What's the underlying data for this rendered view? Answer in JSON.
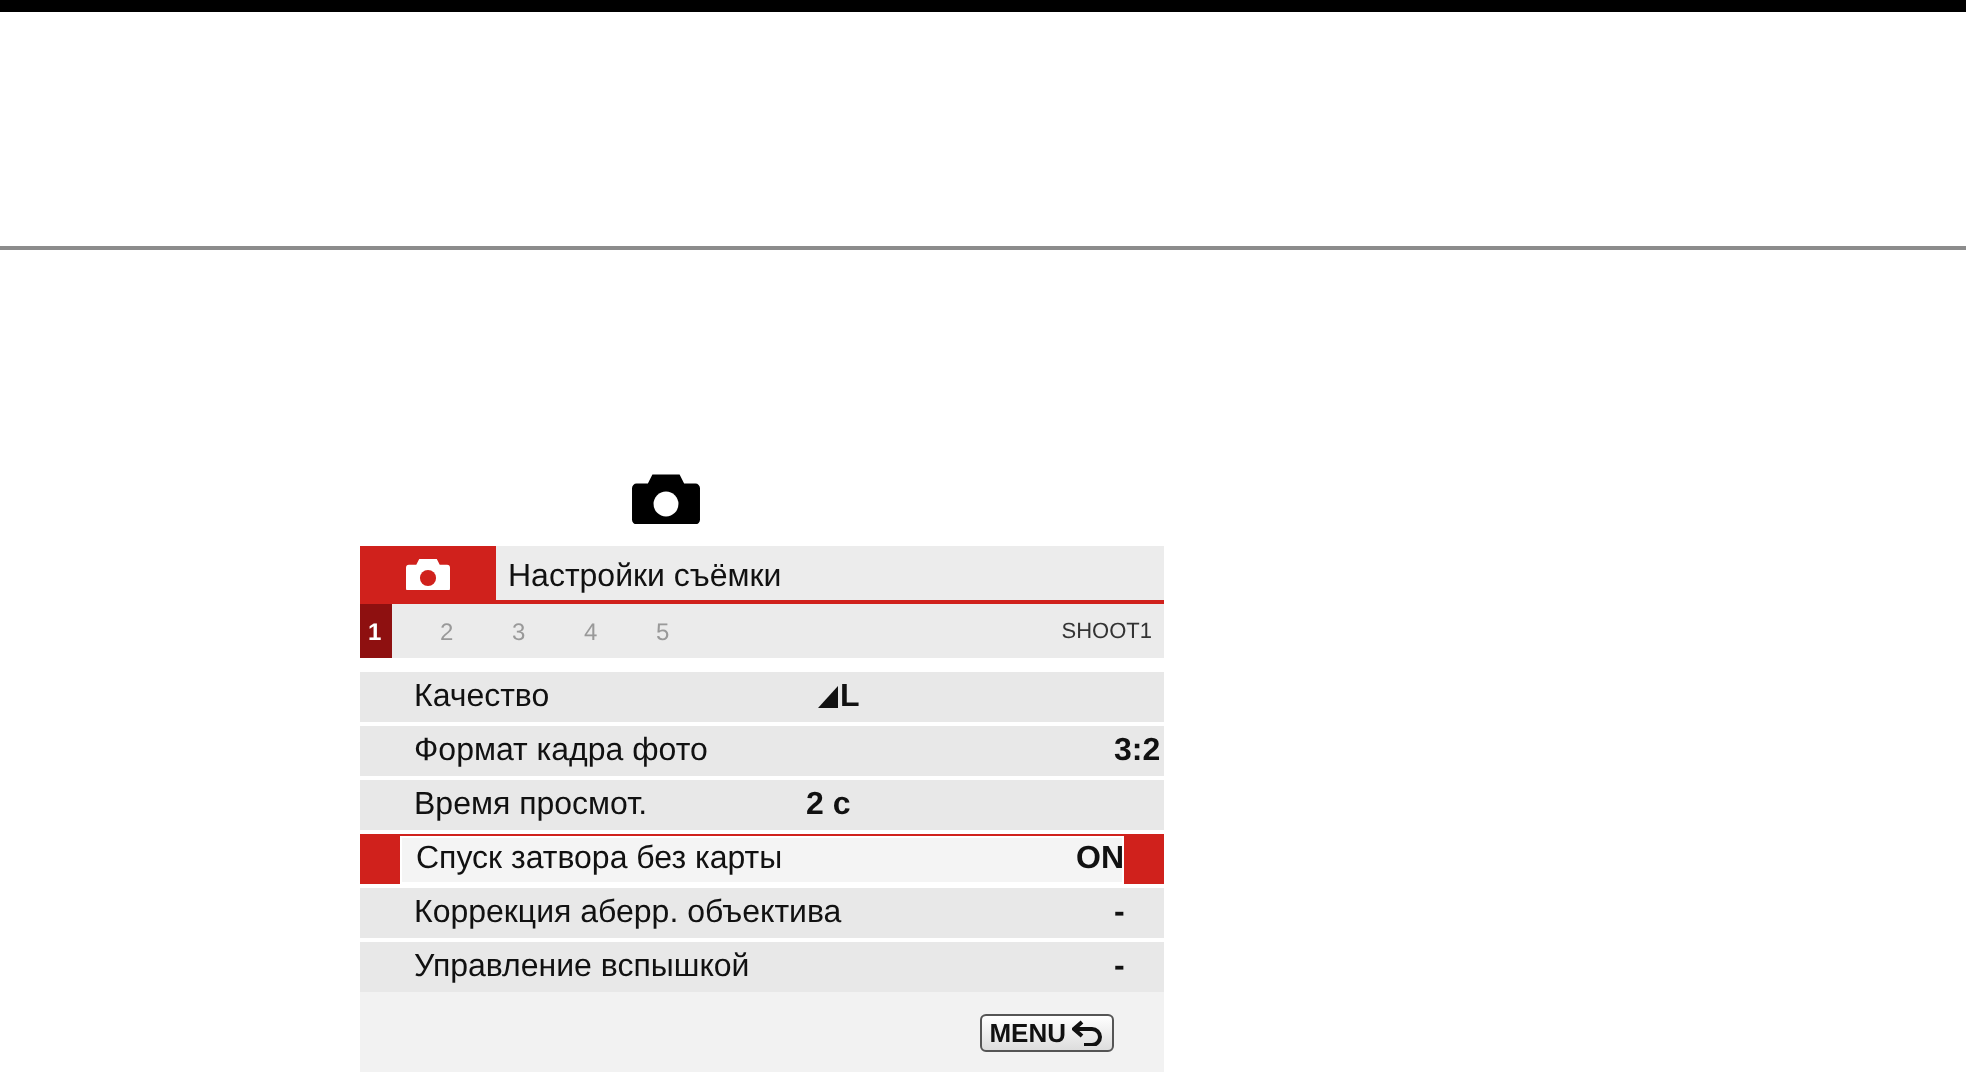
{
  "menu": {
    "title": "Настройки съёмки",
    "page_tabs": [
      {
        "label": "1",
        "selected": true
      },
      {
        "label": "2",
        "selected": false
      },
      {
        "label": "3",
        "selected": false
      },
      {
        "label": "4",
        "selected": false
      },
      {
        "label": "5",
        "selected": false
      }
    ],
    "page_code": "SHOOT1",
    "items": [
      {
        "label": "Качество",
        "value": "L",
        "kind": "quality",
        "selected": false
      },
      {
        "label": "Формат кадра фото",
        "value": "3:2",
        "kind": "end",
        "selected": false
      },
      {
        "label": "Время просмот.",
        "value": "2 с",
        "kind": "middle",
        "selected": false
      },
      {
        "label": "Спуск затвора без карты",
        "value": "ON",
        "kind": "end",
        "selected": true
      },
      {
        "label": "Коррекция аберр. объектива",
        "value": "-",
        "kind": "end",
        "selected": false
      },
      {
        "label": "Управление вспышкой",
        "value": "-",
        "kind": "end",
        "selected": false
      }
    ],
    "back_button": "MENU"
  }
}
